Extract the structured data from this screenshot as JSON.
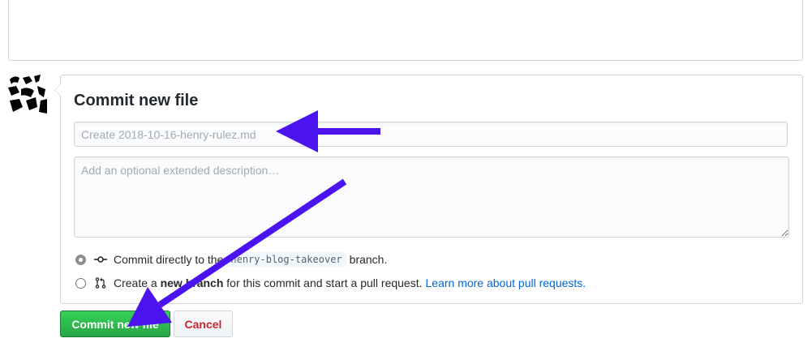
{
  "commit": {
    "title": "Commit new file",
    "summary_placeholder": "Create 2018-10-16-henry-rulez.md",
    "summary_value": "",
    "description_placeholder": "Add an optional extended description…",
    "description_value": "",
    "options": [
      {
        "prefix": "Commit directly to the",
        "branch": "henry-blog-takeover",
        "suffix": "branch.",
        "checked": true
      },
      {
        "prefix": "Create a",
        "bold": "new branch",
        "suffix": "for this commit and start a pull request.",
        "link": "Learn more about pull requests.",
        "checked": false
      }
    ],
    "commit_button": "Commit new file",
    "cancel_button": "Cancel"
  },
  "colors": {
    "annotation_arrow": "#4a13f0",
    "commit_button": "#2cbe4e",
    "cancel_text": "#cb2431",
    "link": "#0366d6"
  },
  "icons": [
    "avatar",
    "git-commit-icon",
    "git-pull-request-icon",
    "annotation-arrow"
  ]
}
